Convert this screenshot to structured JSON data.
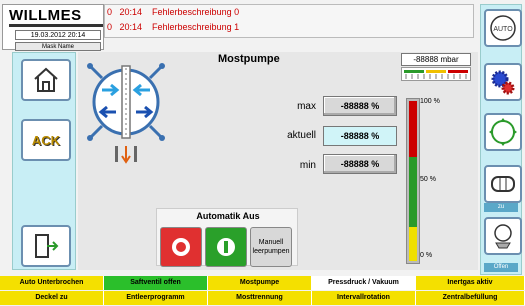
{
  "header": {
    "logo": "WILLMES",
    "date": "19.03.2012 20:14",
    "mask_name": "Mask Name",
    "faults": [
      {
        "code": "0",
        "time": "20:14",
        "text": "Fehlerbeschreibung 0"
      },
      {
        "code": "0",
        "time": "20:14",
        "text": "Fehlerbeschreibung 1"
      }
    ]
  },
  "main": {
    "title": "Mostpumpe",
    "pressure": "-88888 mbar",
    "values": [
      {
        "label": "max",
        "value": "-88888 %"
      },
      {
        "label": "aktuell",
        "value": "-88888 %"
      },
      {
        "label": "min",
        "value": "-88888 %"
      }
    ],
    "bar_scale": [
      "100 %",
      "50 %",
      "0 %"
    ],
    "auto": {
      "title": "Automatik Aus",
      "manual_label_1": "Manuell",
      "manual_label_2": "leerpumpen"
    }
  },
  "left_nav": {
    "ack_label": "ACK"
  },
  "right_nav": {
    "auto_label": "AUTO",
    "zu_label": "zu",
    "offen_label": "Offen"
  },
  "bottom": {
    "row1": [
      {
        "label": "Auto Unterbrochen",
        "color": "#f4e000"
      },
      {
        "label": "Saftventil  offen",
        "color": "#2bbf2b"
      },
      {
        "label": "Mostpumpe",
        "color": "#f4e000"
      },
      {
        "label": "Pressdruck / Vakuum",
        "color": "#ffffff"
      },
      {
        "label": "Inertgas aktiv",
        "color": "#f4e000"
      }
    ],
    "row2": [
      {
        "label": "Deckel zu"
      },
      {
        "label": "Entleerprogramm"
      },
      {
        "label": "Mosttrennung"
      },
      {
        "label": "Intervallrotation"
      },
      {
        "label": "Zentralbefüllung"
      }
    ]
  },
  "colors": {
    "accent": "#6b8fb0",
    "panel": "#c8eef5",
    "bar_red": "#cc0000",
    "bar_green": "#2a9a2a",
    "bar_yellow": "#f0e000"
  }
}
